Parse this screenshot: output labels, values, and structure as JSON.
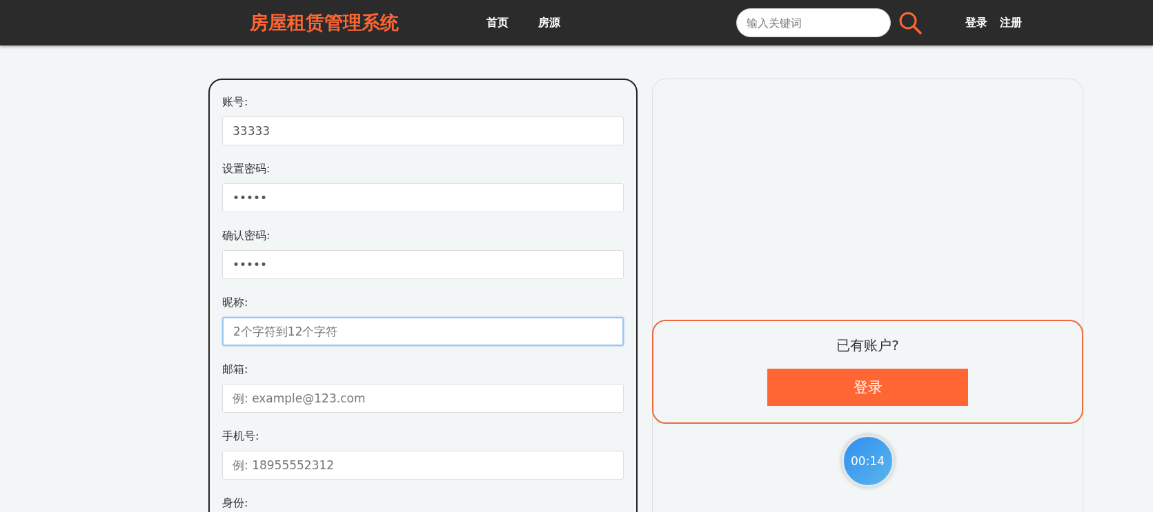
{
  "header": {
    "logo": "房屋租赁管理系统",
    "nav": [
      {
        "label": "首页"
      },
      {
        "label": "房源"
      }
    ],
    "search": {
      "placeholder": "输入关键词"
    },
    "auth_links": [
      {
        "label": "登录"
      },
      {
        "label": "注册"
      }
    ]
  },
  "register_form": {
    "fields": [
      {
        "label": "账号:",
        "value": "33333",
        "focused": false
      },
      {
        "label": "设置密码:",
        "value": "•••••",
        "focused": false
      },
      {
        "label": "确认密码:",
        "value": "•••••",
        "focused": false
      },
      {
        "label": "昵称:",
        "placeholder": "2个字符到12个字符",
        "focused": true
      },
      {
        "label": "邮箱:",
        "placeholder": "例: example@123.com",
        "focused": false
      },
      {
        "label": "手机号:",
        "placeholder": "例: 18955552312",
        "focused": false
      },
      {
        "label": "身份:"
      }
    ]
  },
  "login_panel": {
    "prompt": "已有账户?",
    "button": "登录"
  },
  "timer": "00:14"
}
